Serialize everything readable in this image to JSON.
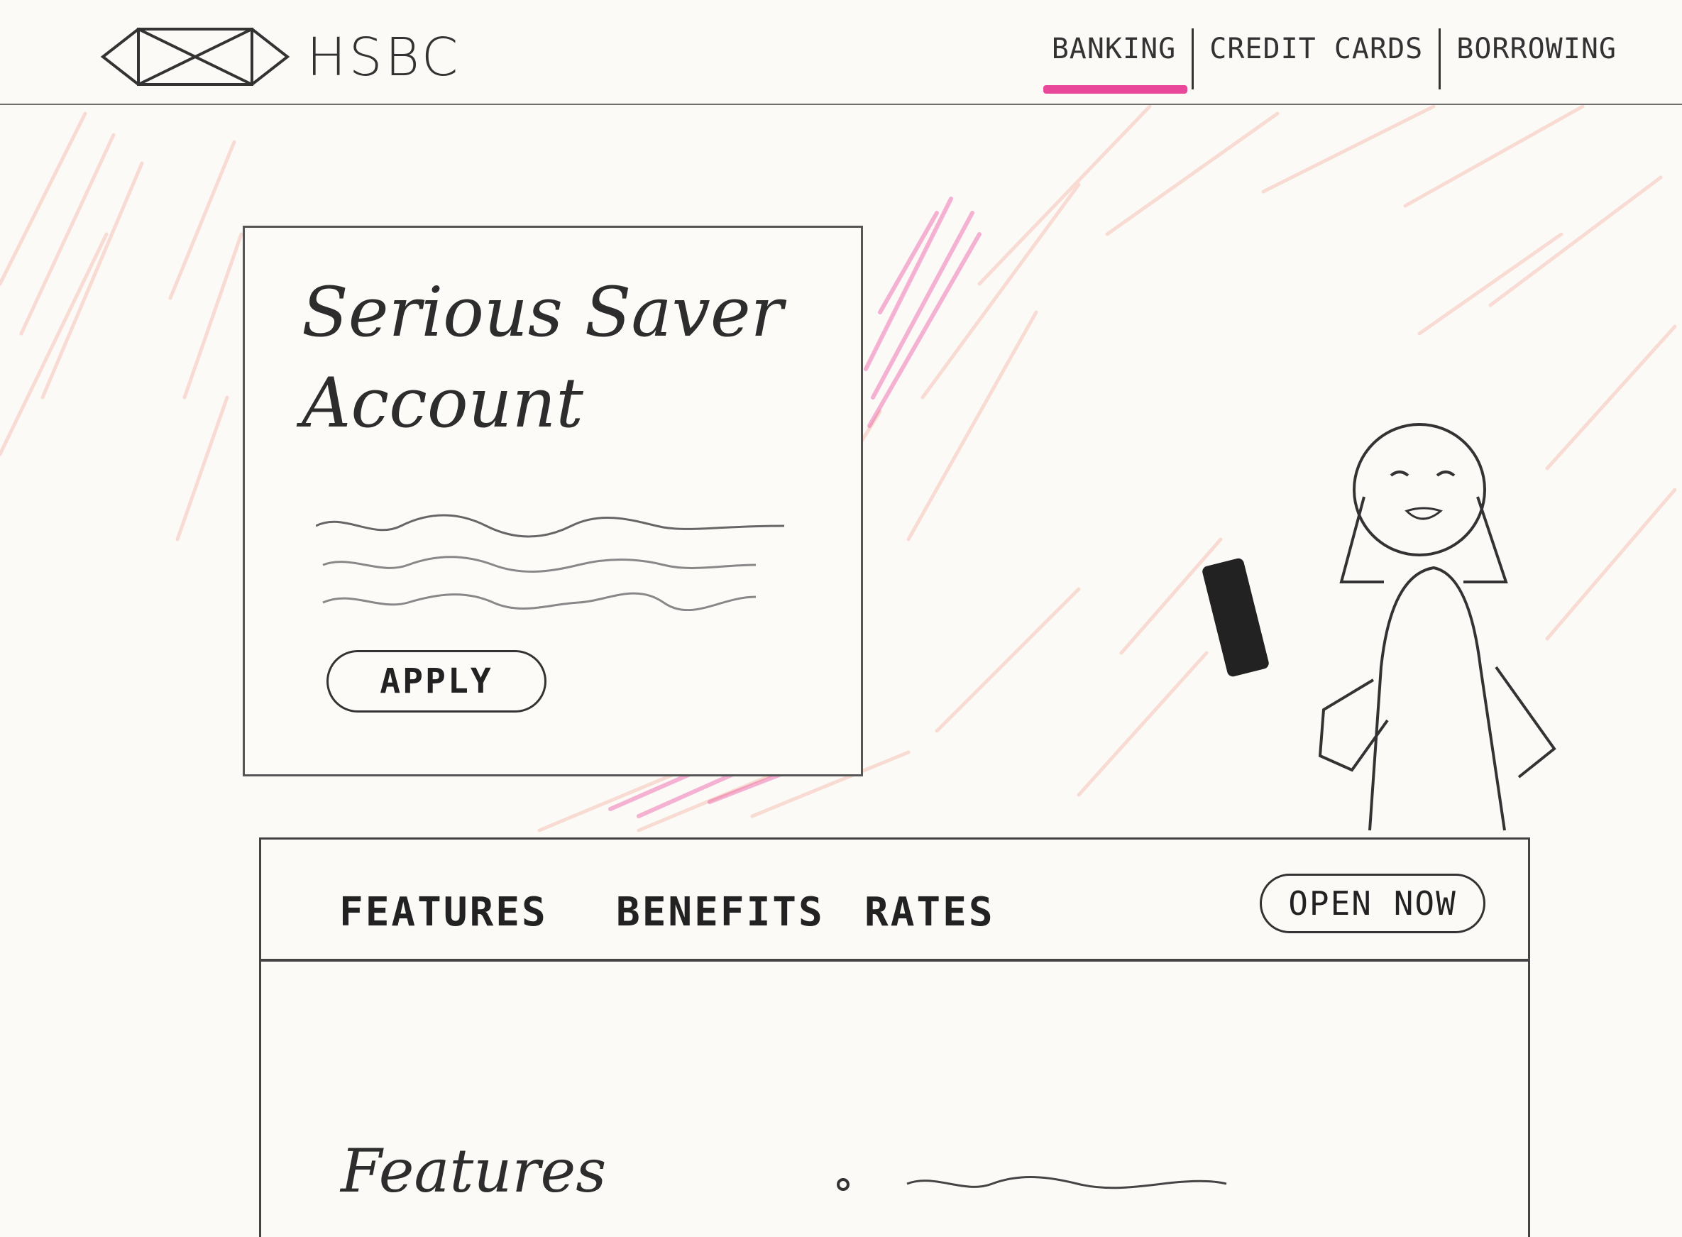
{
  "header": {
    "brand_name": "HSBC",
    "logo_icon": "hsbc-hexagon-logo",
    "nav_items": [
      {
        "label": "BANKING",
        "active": true
      },
      {
        "label": "CREDIT CARDS",
        "active": false
      },
      {
        "label": "BORROWING",
        "active": false
      }
    ],
    "active_accent_color": "#e9479a"
  },
  "hero": {
    "title": "Serious Saver\nAccount",
    "apply_label": "APPLY",
    "background_accent_colors": [
      "#f5b8a8",
      "#e9479a"
    ]
  },
  "panel": {
    "tabs": [
      "FEATURES",
      "BENEFITS",
      "RATES"
    ],
    "open_now_label": "OPEN NOW",
    "section_heading": "Features"
  }
}
